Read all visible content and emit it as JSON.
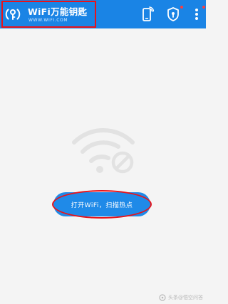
{
  "header": {
    "title": "WiFi万能钥匙",
    "url": "WWW.WIFI.COM",
    "logo_icon": "wifi-key-logo",
    "action_icons": [
      "phone-signal-icon",
      "shield-icon",
      "more-vert-icon"
    ],
    "bar_color": "#1a84e5"
  },
  "main": {
    "illustration_icon": "wifi-disabled-icon",
    "open_wifi_button_label": "打开WiFi，扫描热点"
  },
  "annotations": {
    "highlight_color": "#e8131a"
  },
  "watermark": {
    "text": "头条@悟空问答"
  }
}
